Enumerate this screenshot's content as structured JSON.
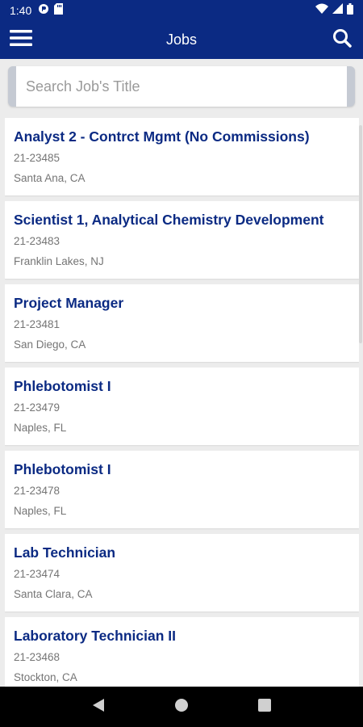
{
  "status_bar": {
    "time": "1:40",
    "left_icons": [
      "data-saver-icon",
      "sd-card-icon"
    ],
    "right_icons": [
      "wifi-icon",
      "signal-icon",
      "battery-icon"
    ]
  },
  "app_bar": {
    "title": "Jobs",
    "menu_icon": "hamburger-menu-icon",
    "search_icon": "search-icon"
  },
  "search": {
    "placeholder": "Search Job's Title",
    "value": ""
  },
  "jobs": [
    {
      "title": "Analyst 2 - Contrct Mgmt (No Commissions)",
      "id": "21-23485",
      "location": "Santa Ana, CA"
    },
    {
      "title": "Scientist 1, Analytical Chemistry Development",
      "id": "21-23483",
      "location": "Franklin Lakes, NJ"
    },
    {
      "title": "Project Manager",
      "id": "21-23481",
      "location": "San Diego, CA"
    },
    {
      "title": "Phlebotomist I",
      "id": "21-23479",
      "location": "Naples, FL"
    },
    {
      "title": "Phlebotomist I",
      "id": "21-23478",
      "location": "Naples, FL"
    },
    {
      "title": "Lab Technician",
      "id": "21-23474",
      "location": "Santa Clara, CA"
    },
    {
      "title": "Laboratory Technician II",
      "id": "21-23468",
      "location": "Stockton, CA"
    }
  ],
  "nav_bar": {
    "buttons": [
      "back-icon",
      "home-icon",
      "recents-icon"
    ]
  },
  "colors": {
    "brand": "#0b2a83",
    "background": "#ececec",
    "card": "#ffffff",
    "secondary_text": "#757575"
  }
}
